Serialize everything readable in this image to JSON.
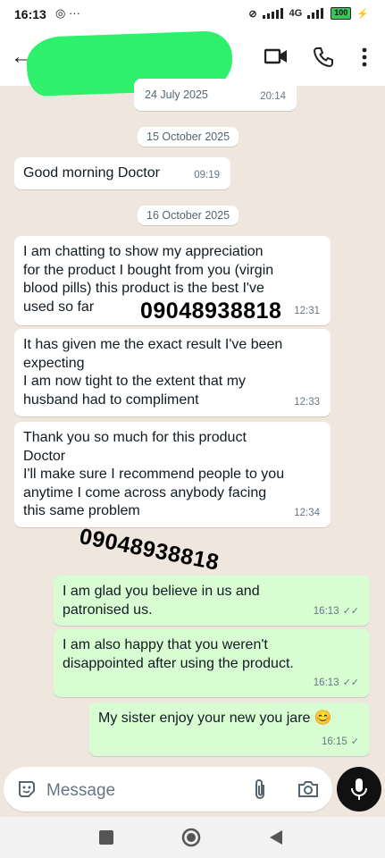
{
  "status_bar": {
    "time": "16:13",
    "left_icons": "◎ ···",
    "network": "4G",
    "battery": "100"
  },
  "header": {
    "icons": [
      "back-arrow-icon",
      "video-call-icon",
      "phone-icon",
      "more-options-icon"
    ]
  },
  "messages": {
    "top_partial_time": "20:14",
    "date_1": "24 July 2025",
    "date_2": "15 October 2025",
    "m1_text": "Good morning Doctor",
    "m1_time": "09:19",
    "date_3": "16 October 2025",
    "m2_text": "I am chatting to show my appreciation\nfor the product I bought from you (virgin\nblood pills) this product is the best I've\nused so far",
    "m2_time": "12:31",
    "m3_text": "It has given me the exact result I've been\nexpecting\nI am now tight to the extent that my\nhusband had to compliment",
    "m3_time": "12:33",
    "m4_text": "Thank you so much for this product\nDoctor\nI'll make sure I recommend people to you\nanytime I come across anybody facing\nthis same problem",
    "m4_time": "12:34",
    "m5_text": "I am glad you believe in us and\npatronised us.",
    "m5_time": "16:13",
    "m6_text": "I am also happy that you weren't\ndisappointed after using the product.",
    "m6_time": "16:13",
    "m7_text": "My sister enjoy your new you jare 😊",
    "m7_time": "16:15"
  },
  "watermarks": {
    "phone_1": "09048938818",
    "phone_2": "09048938818"
  },
  "composer": {
    "placeholder": "Message"
  }
}
